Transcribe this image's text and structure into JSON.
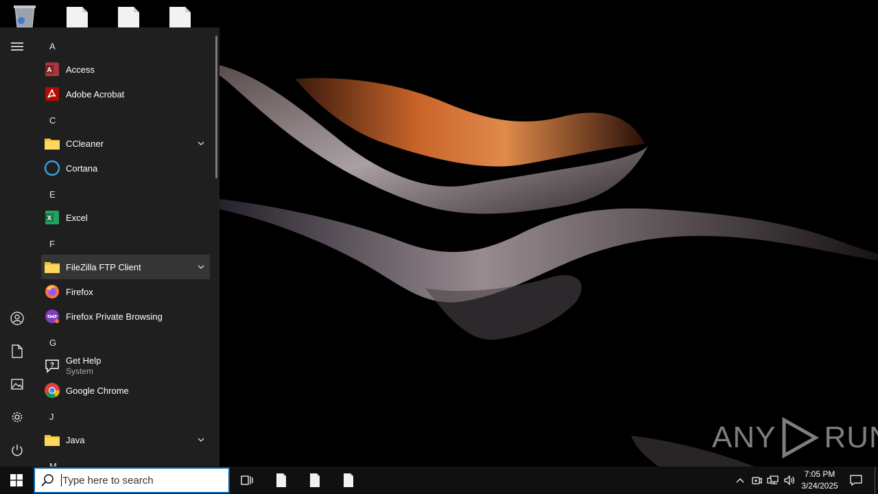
{
  "start_menu": {
    "letters": {
      "a": "A",
      "c": "C",
      "e": "E",
      "f": "F",
      "g": "G",
      "j": "J",
      "m": "M"
    },
    "apps": {
      "access": "Access",
      "acrobat": "Adobe Acrobat",
      "ccleaner": "CCleaner",
      "cortana": "Cortana",
      "excel": "Excel",
      "filezilla": "FileZilla FTP Client",
      "firefox": "Firefox",
      "firefox_private": "Firefox Private Browsing",
      "gethelp": "Get Help",
      "gethelp_sub": "System",
      "chrome": "Google Chrome",
      "java": "Java"
    },
    "rail_icons": [
      "hamburger-icon",
      "user-icon",
      "document-icon",
      "pictures-icon",
      "gear-icon",
      "power-icon"
    ]
  },
  "taskbar": {
    "search_placeholder": "Type here to search",
    "time": "7:05 PM",
    "date": "3/24/2025"
  },
  "watermark": {
    "text_left": "ANY",
    "text_right": "RUN"
  },
  "colors": {
    "start_bg": "#1f1f1f",
    "taskbar_bg": "#101010",
    "accent": "#0063b1"
  }
}
